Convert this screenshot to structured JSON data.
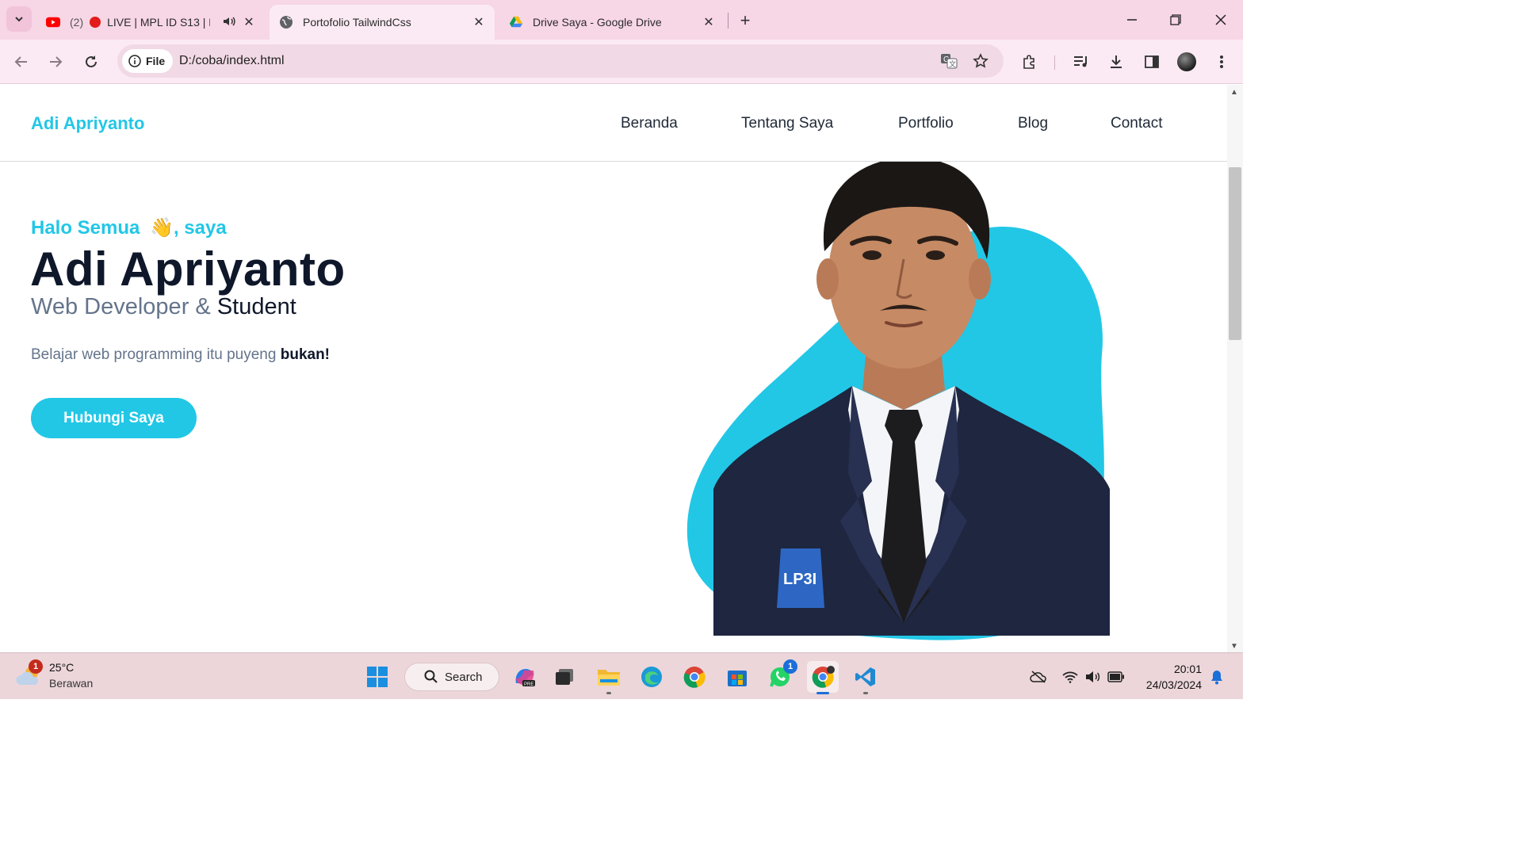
{
  "browser": {
    "tabs": [
      {
        "prefix": "(2)",
        "title": "LIVE | MPL ID S13 | Ro",
        "icon": "youtube-icon",
        "audio": true
      },
      {
        "title": "Portofolio TailwindCss",
        "icon": "globe-icon",
        "active": true
      },
      {
        "title": "Drive Saya - Google Drive",
        "icon": "google-drive-icon"
      }
    ],
    "security_chip": "File",
    "url": "D:/coba/index.html"
  },
  "site": {
    "brand": "Adi Apriyanto",
    "nav": [
      "Beranda",
      "Tentang Saya",
      "Portfolio",
      "Blog",
      "Contact"
    ],
    "hero": {
      "greeting": "Halo Semua",
      "greeting_emoji": "👋",
      "greeting_suffix": ", saya",
      "name": "Adi Apriyanto",
      "role_a": "Web Developer &",
      "role_b": "Student",
      "desc": "Belajar web programming itu puyeng",
      "desc_bold": "bukan!",
      "cta": "Hubungi Saya",
      "badge_text": "LP3I"
    },
    "accent": "#22c7e6"
  },
  "taskbar": {
    "weather_temp": "25°C",
    "weather_cond": "Berawan",
    "weather_badge": "1",
    "search_label": "Search",
    "whatsapp_badge": "1",
    "time": "20:01",
    "date": "24/03/2024"
  }
}
